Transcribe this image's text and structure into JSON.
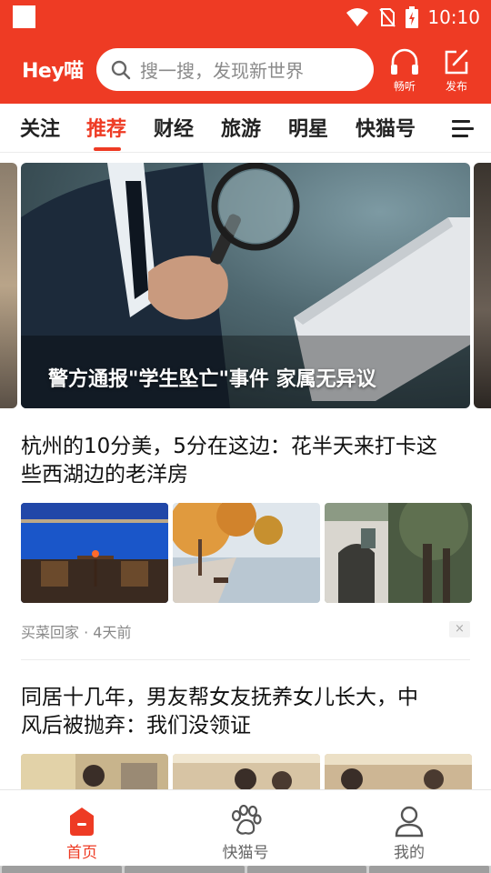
{
  "status_bar": {
    "time": "10:10"
  },
  "header": {
    "logo": "Hey喵",
    "search_placeholder": "搜一搜，发现新世界",
    "listen_label": "畅听",
    "publish_label": "发布"
  },
  "tabs": [
    {
      "label": "关注"
    },
    {
      "label": "推荐",
      "active": true
    },
    {
      "label": "财经"
    },
    {
      "label": "旅游"
    },
    {
      "label": "明星"
    },
    {
      "label": "快猫号"
    }
  ],
  "banner": {
    "caption": "警方通报\"学生坠亡\"事件 家属无异议"
  },
  "articles": [
    {
      "title_line1": "杭州的10分美，5分在这边：花半天来打卡这",
      "title_line2": "些西湖边的老洋房",
      "meta": "买菜回家 · 4天前",
      "close": "×"
    },
    {
      "title_line1": "同居十几年，男友帮女友抚养女儿长大，中",
      "title_line2": "风后被抛弃：我们没领证"
    }
  ],
  "bottom_nav": [
    {
      "label": "首页",
      "active": true
    },
    {
      "label": "快猫号"
    },
    {
      "label": "我的"
    }
  ],
  "colors": {
    "brand": "#ee3b24"
  }
}
